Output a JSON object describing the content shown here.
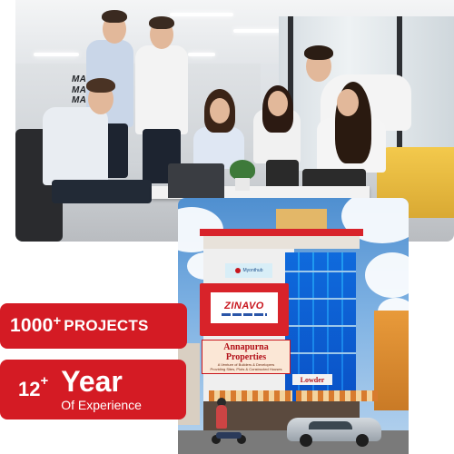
{
  "office_photo": {
    "wall_text": [
      "MAKE",
      "MAKE IT",
      "MAKE IT H",
      "MAKE",
      "MAKE IT"
    ]
  },
  "building_photo": {
    "signs": {
      "zinavo": "ZINAVO",
      "small_sign": "Myonthub",
      "annapurna_title": "Annapurna Properties",
      "annapurna_sub_1": "A Venture of Builders & Developers",
      "annapurna_sub_2": "Providing Sites, Plots & Constructed Houses",
      "lowder": "Lowder"
    }
  },
  "stats": {
    "projects": {
      "number": "1000",
      "suffix": "+",
      "label": "PROJECTS"
    },
    "experience": {
      "number": "12",
      "suffix": "+",
      "big": "Year",
      "small": "Of Experience"
    }
  },
  "colors": {
    "accent_red": "#d41b24"
  }
}
